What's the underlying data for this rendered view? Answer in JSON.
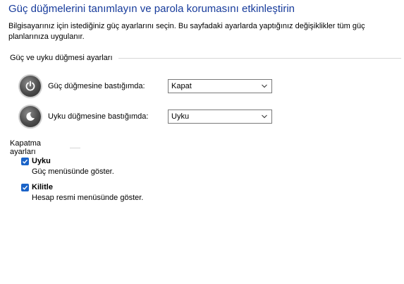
{
  "header": {
    "title": "Güç düğmelerini tanımlayın ve parola korumasını etkinleştirin",
    "intro": "Bilgisayarınız için istediğiniz güç ayarlarını seçin. Bu sayfadaki ayarlarda yaptığınız değişiklikler tüm güç planlarınıza uygulanır."
  },
  "power_settings": {
    "group_label": "Güç ve uyku düğmesi ayarları",
    "rows": [
      {
        "icon": "power-button-icon",
        "label": "Güç düğmesine bastığımda:",
        "selected": "Kapat"
      },
      {
        "icon": "sleep-button-icon",
        "label": "Uyku düğmesine bastığımda:",
        "selected": "Uyku"
      }
    ]
  },
  "shutdown_settings": {
    "group_label": "Kapatma ayarları",
    "items": [
      {
        "label": "Uyku",
        "description": "Güç menüsünde göster.",
        "checked": true
      },
      {
        "label": "Kilitle",
        "description": "Hesap resmi menüsünde göster.",
        "checked": true
      }
    ]
  },
  "colors": {
    "title": "#173b9b",
    "checkbox": "#1a63c8"
  }
}
